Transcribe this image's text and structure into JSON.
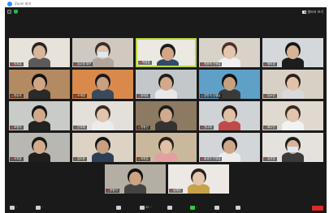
{
  "window": {
    "title": "Zoom 회의"
  },
  "topbar": {
    "view_label": "갤러리 보기"
  },
  "participants": [
    {
      "name": "이지은",
      "bg": "#e7e2da",
      "skin": "#d9b59b",
      "hair": "#2a2420",
      "cloth": "#5a5a5a",
      "mask": false,
      "active": false
    },
    {
      "name": "김수정 대구",
      "bg": "#cfc9c1",
      "skin": "#e0c2a8",
      "hair": "#3a2e27",
      "cloth": "#b0a69b",
      "mask": true,
      "active": false
    },
    {
      "name": "박정훈",
      "bg": "#ece8e2",
      "skin": "#d4a586",
      "hair": "#1b1b1b",
      "cloth": "#2f4a6b",
      "mask": false,
      "active": true
    },
    {
      "name": "최윤희 선생님",
      "bg": "#d9d2c8",
      "skin": "#e3c6ae",
      "hair": "#4a3328",
      "cloth": "#f0f0f0",
      "mask": false,
      "active": false
    },
    {
      "name": "정미경",
      "bg": "#d5d8db",
      "skin": "#d8b396",
      "hair": "#171717",
      "cloth": "#1d1d1d",
      "mask": false,
      "active": false
    },
    {
      "name": "한승우",
      "bg": "#b48a62",
      "skin": "#d0a684",
      "hair": "#111111",
      "cloth": "#2a2a2a",
      "mask": false,
      "active": false
    },
    {
      "name": "오세영",
      "bg": "#d98a4a",
      "skin": "#c8a080",
      "hair": "#1a1a1a",
      "cloth": "#3b4a5a",
      "mask": false,
      "active": false
    },
    {
      "name": "윤태호",
      "bg": "#c3c7ca",
      "skin": "#d3a98b",
      "hair": "#1e1e1e",
      "cloth": "#e8e8e8",
      "mask": false,
      "active": false
    },
    {
      "name": "강민석 선생님",
      "bg": "#5fa0c9",
      "skin": "#c9a07f",
      "hair": "#121212",
      "cloth": "#3a3a3a",
      "mask": false,
      "active": false
    },
    {
      "name": "임소연",
      "bg": "#d8d0c4",
      "skin": "#e2c3aa",
      "hair": "#2c211a",
      "cloth": "#d9d9d9",
      "mask": false,
      "active": false
    },
    {
      "name": "조현우",
      "bg": "#c9cbc8",
      "skin": "#d1a98a",
      "hair": "#141414",
      "cloth": "#222222",
      "mask": false,
      "active": false
    },
    {
      "name": "신지혜",
      "bg": "#e3dfd9",
      "skin": "#e1c4ad",
      "hair": "#3a2b22",
      "cloth": "#ececec",
      "mask": false,
      "active": false
    },
    {
      "name": "장동건",
      "bg": "#8c7a62",
      "skin": "#d1a98c",
      "hair": "#1b1b1b",
      "cloth": "#333333",
      "mask": false,
      "active": false
    },
    {
      "name": "권나래",
      "bg": "#cfd3d6",
      "skin": "#e0c0a6",
      "hair": "#2a1e17",
      "cloth": "#c04a4a",
      "mask": false,
      "active": false
    },
    {
      "name": "배수민",
      "bg": "#dfd9d0",
      "skin": "#e2c5ae",
      "hair": "#3b2a20",
      "cloth": "#f2f2f2",
      "mask": false,
      "active": false
    },
    {
      "name": "서지훈",
      "bg": "#b9b7b2",
      "skin": "#d4ab8b",
      "hair": "#171717",
      "cloth": "#1f1f1f",
      "mask": false,
      "active": false
    },
    {
      "name": "김도윤",
      "bg": "#dcd3c5",
      "skin": "#c99f80",
      "hair": "#141414",
      "cloth": "#2d3e57",
      "mask": false,
      "active": false
    },
    {
      "name": "이하은",
      "bg": "#c9b89c",
      "skin": "#e1c1a5",
      "hair": "#2b1f18",
      "cloth": "#e2a0a0",
      "mask": false,
      "active": false
    },
    {
      "name": "홍성민 선생님",
      "bg": "#d2d6d9",
      "skin": "#d0a688",
      "hair": "#121212",
      "cloth": "#ececec",
      "mask": false,
      "active": false
    },
    {
      "name": "유진영",
      "bg": "#e5e2de",
      "skin": "#d9b497",
      "hair": "#1c1c1c",
      "cloth": "#3a3a3a",
      "mask": true,
      "active": false
    },
    {
      "name": "문현석",
      "bg": "#b5aea4",
      "skin": "#cfa283",
      "hair": "#111111",
      "cloth": "#444444",
      "mask": false,
      "active": false
    },
    {
      "name": "송예린",
      "bg": "#ece9e4",
      "skin": "#e3c6ae",
      "hair": "#2a2019",
      "cloth": "#c7a24a",
      "mask": false,
      "active": false
    }
  ],
  "toolbar": {
    "participants_count": "22"
  }
}
